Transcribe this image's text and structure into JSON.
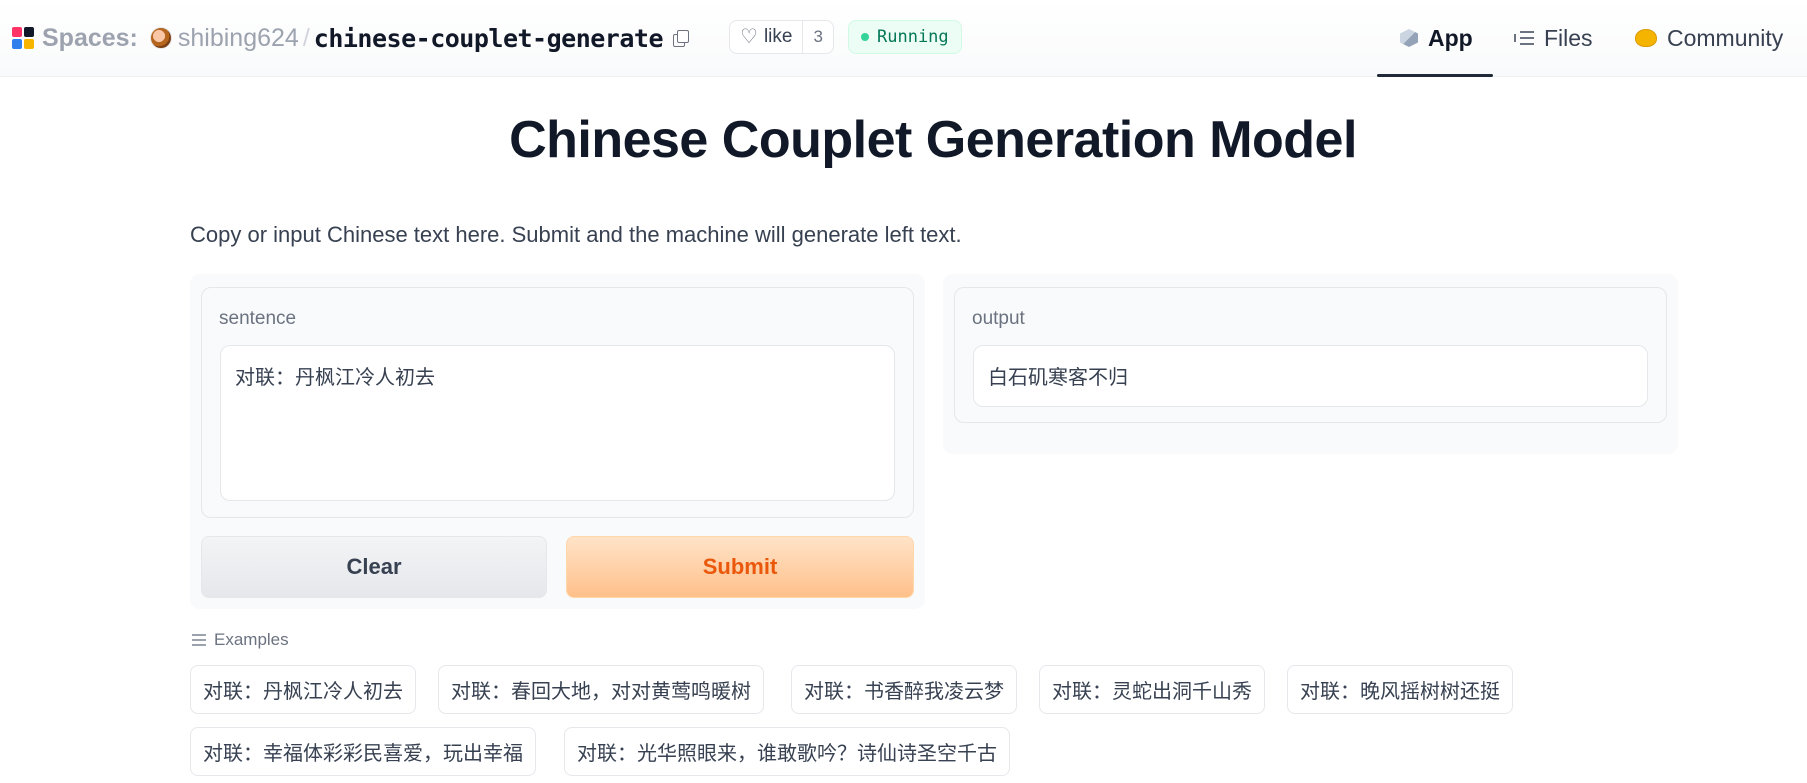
{
  "header": {
    "spaces_label": "Spaces:",
    "owner": "shibing624",
    "separator": "/",
    "repo": "chinese-couplet-generate",
    "like_label": "like",
    "like_count": "3",
    "status": "Running",
    "tabs": [
      {
        "label": "App",
        "icon": "cube-icon",
        "active": true
      },
      {
        "label": "Files",
        "icon": "files-icon",
        "active": false
      },
      {
        "label": "Community",
        "icon": "community-icon",
        "active": false
      }
    ]
  },
  "main": {
    "title": "Chinese Couplet Generation Model",
    "description": "Copy or input Chinese text here. Submit and the machine will generate left text.",
    "input": {
      "label": "sentence",
      "value": "对联：丹枫江冷人初去"
    },
    "output": {
      "label": "output",
      "value": "白石矶寒客不归"
    },
    "buttons": {
      "clear": "Clear",
      "submit": "Submit"
    },
    "examples_label": "Examples",
    "examples": [
      "对联：丹枫江冷人初去",
      "对联：春回大地，对对黄莺鸣暖树",
      "对联：书香醉我凌云梦",
      "对联：灵蛇出洞千山秀",
      "对联：晚风摇树树还挺",
      "对联：幸福体彩彩民喜爱，玩出幸福",
      "对联：光华照眼来，谁敢歌吟？诗仙诗圣空千古"
    ]
  },
  "colors": {
    "accent": "#ea580c",
    "status": "#047857",
    "submit_bg": "#ffc08a"
  }
}
